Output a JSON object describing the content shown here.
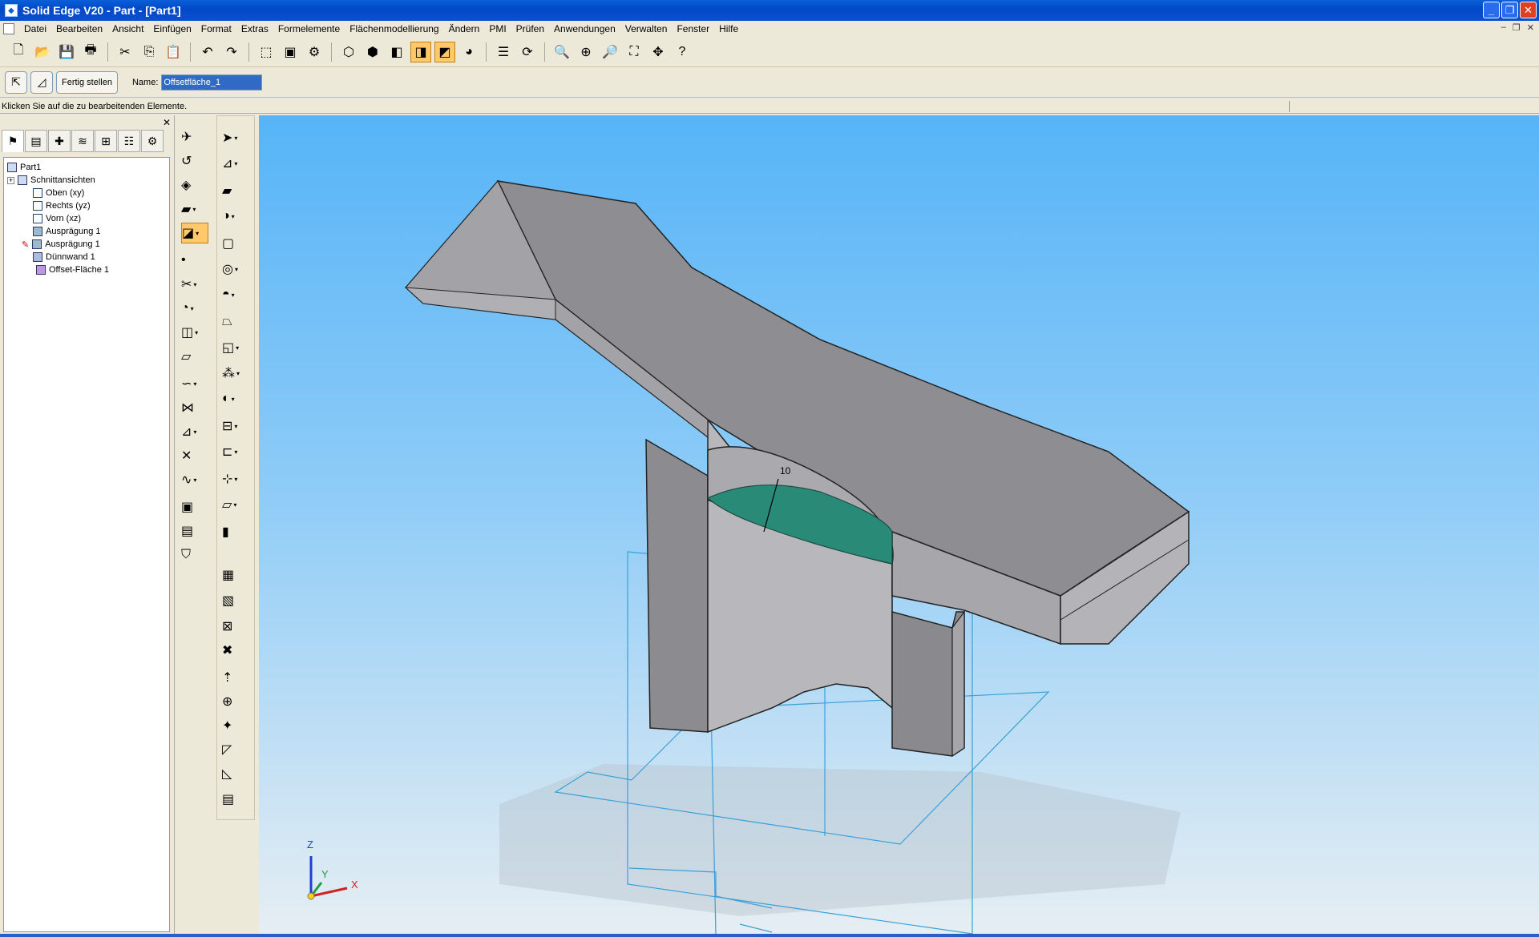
{
  "window": {
    "title": "Solid Edge V20 - Part - [Part1]"
  },
  "menu": [
    "Datei",
    "Bearbeiten",
    "Ansicht",
    "Einfügen",
    "Format",
    "Extras",
    "Formelemente",
    "Flächenmodellierung",
    "Ändern",
    "PMI",
    "Prüfen",
    "Anwendungen",
    "Verwalten",
    "Fenster",
    "Hilfe"
  ],
  "ribbon": {
    "done_label": "Fertig stellen",
    "name_label": "Name:",
    "name_value": "Offsetfläche_1"
  },
  "prompt": "Klicken Sie auf die zu bearbeitenden Elemente.",
  "tree": {
    "root": "Part1",
    "items": [
      "Schnittansichten",
      "Oben (xy)",
      "Rechts (yz)",
      "Vorn (xz)",
      "Ausprägung 1",
      "Ausprägung 1",
      "Dünnwand 1",
      "Offset-Fläche 1"
    ]
  },
  "viewport": {
    "dimension_value": "10"
  },
  "triad": {
    "x": "X",
    "y": "Y",
    "z": "Z"
  },
  "colors": {
    "title_bar": "#0a5fd9",
    "viewport_top": "#56b4f7",
    "selected_face": "#2a8a78",
    "part_face": "#9a9a9c",
    "plane_lines": "#3aa0d8"
  }
}
